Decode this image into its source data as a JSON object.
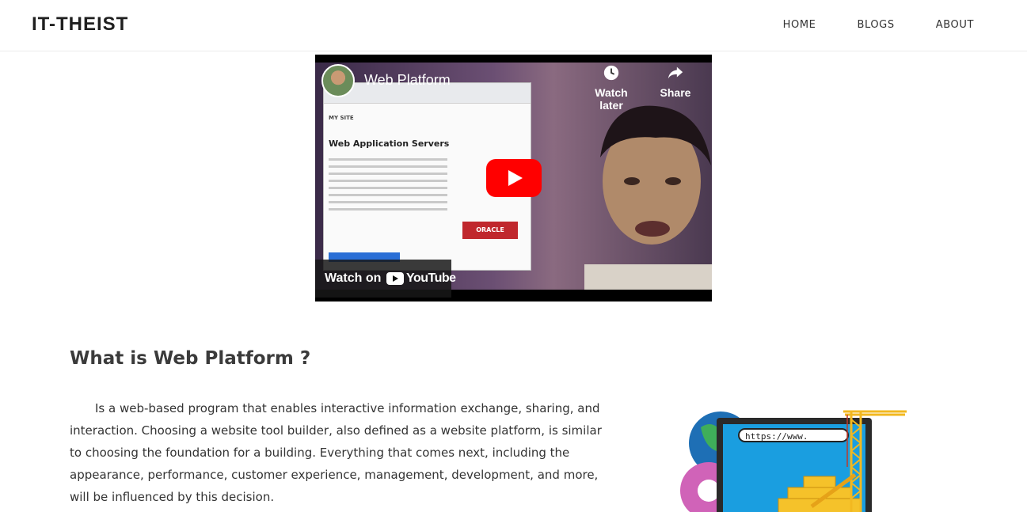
{
  "header": {
    "logo": "IT-THEIST",
    "nav": [
      {
        "label": "HOME"
      },
      {
        "label": "BLOGS"
      },
      {
        "label": "ABOUT"
      }
    ]
  },
  "video": {
    "title": "Web Platform",
    "watch_later": "Watch later",
    "share": "Share",
    "watch_on": "Watch on",
    "youtube": "YouTube",
    "screen": {
      "site_label": "MY SITE",
      "page_title": "Web Application Servers",
      "oracle_label": "ORACLE"
    },
    "colors": {
      "play": "#ff0000"
    }
  },
  "main": {
    "heading": "What is Web Platform ?",
    "paragraph": "Is a web-based program that enables interactive information exchange, sharing, and interaction. Choosing a website tool builder, also defined as a website platform, is similar to choosing the foundation for a building. Everything that comes next, including the appearance, performance, customer experience, management, development, and more, will be influenced by this decision."
  },
  "illustration": {
    "url_text": "https://www."
  }
}
